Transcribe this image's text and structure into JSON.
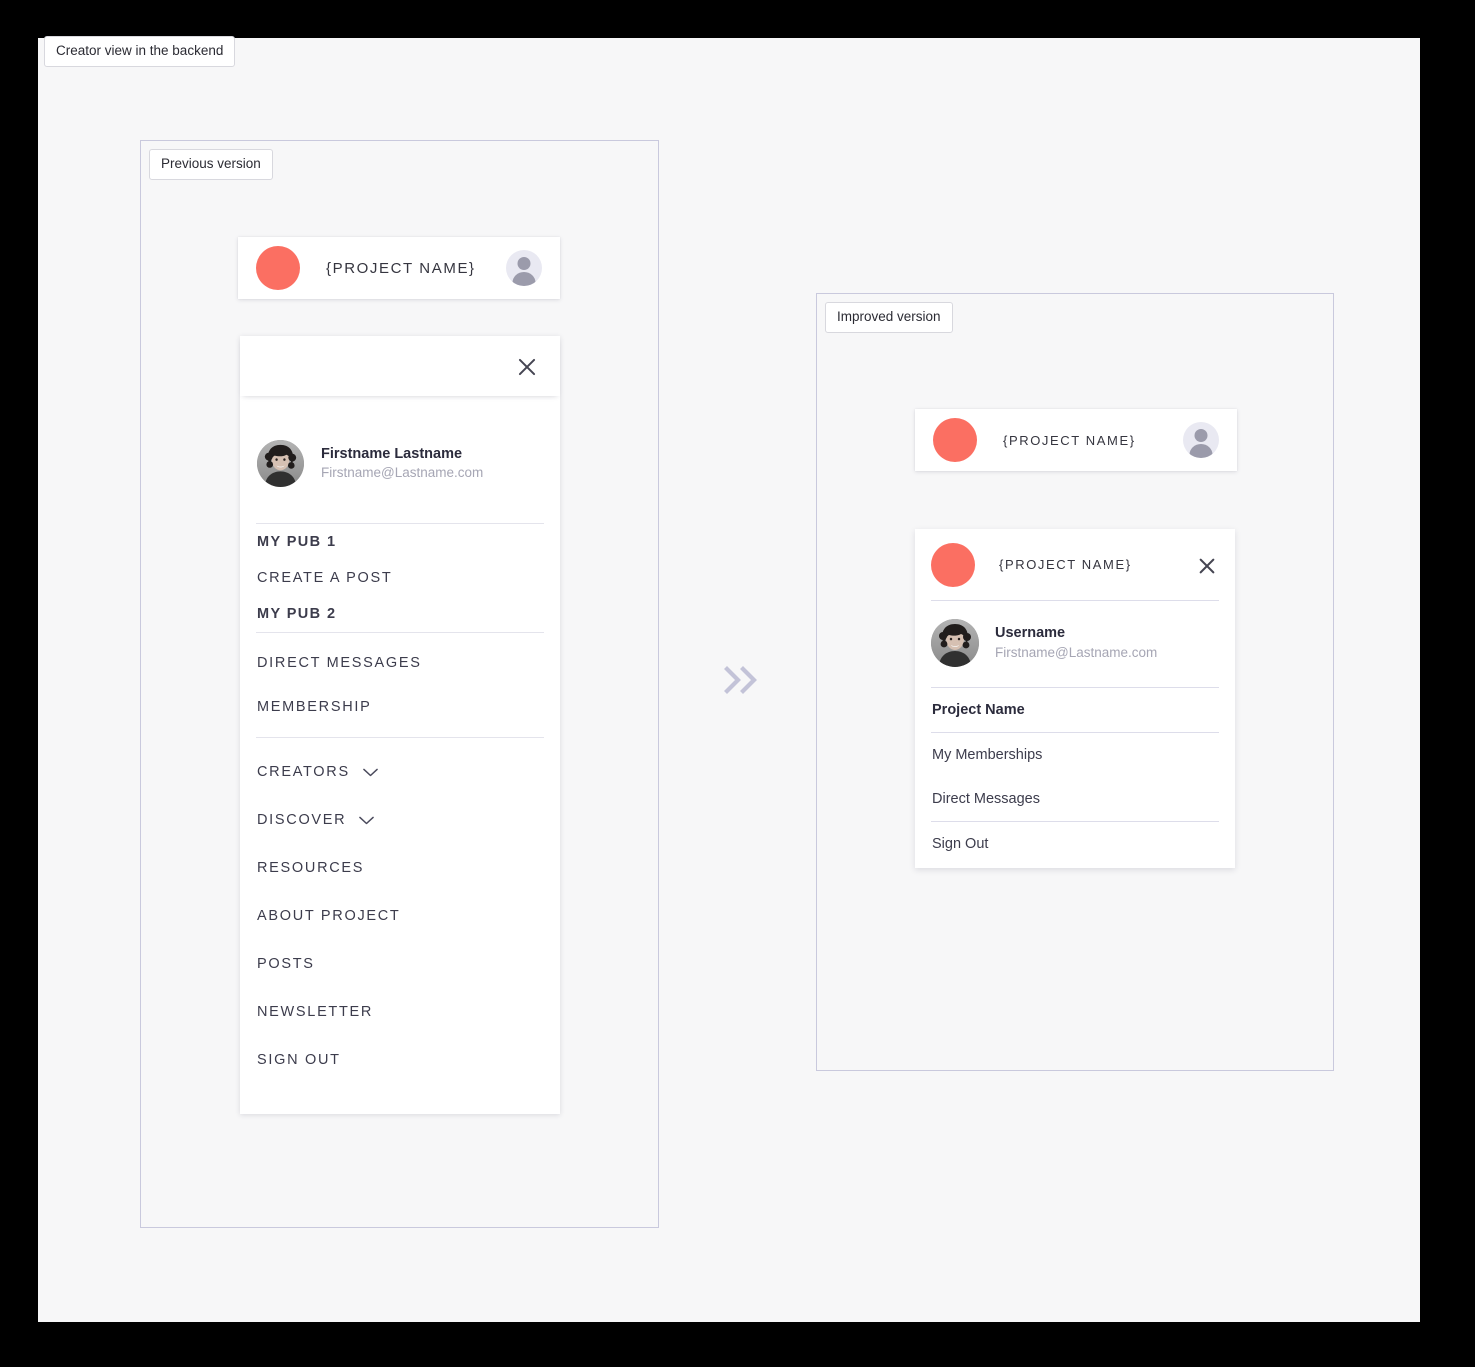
{
  "page": {
    "main_label": "Creator view in the backend",
    "canvas_bg": "#f7f7f8",
    "accent_color": "#fb6f62",
    "panel_border_color": "#c9c9dd"
  },
  "previous": {
    "label": "Previous version",
    "topbar": {
      "brand_icon": "brand-dot-icon",
      "project_name": "{PROJECT NAME}",
      "avatar_icon": "user-avatar-icon"
    },
    "menu": {
      "close_icon": "close-icon",
      "user": {
        "avatar_icon": "user-photo-avatar",
        "name": "Firstname Lastname",
        "email": "Firstname@Lastname.com"
      },
      "group_pubs": [
        {
          "label": "MY PUB 1",
          "style": "bold"
        },
        {
          "label": "CREATE A POST",
          "style": "indent"
        },
        {
          "label": "MY PUB 2",
          "style": "bold"
        }
      ],
      "group_primary": [
        {
          "label": "DIRECT MESSAGES"
        },
        {
          "label": "MEMBERSHIP"
        }
      ],
      "group_secondary": [
        {
          "label": "CREATORS",
          "chevron": "chevron-down-icon"
        },
        {
          "label": "DISCOVER",
          "chevron": "chevron-down-icon"
        },
        {
          "label": "RESOURCES"
        },
        {
          "label": "ABOUT PROJECT"
        },
        {
          "label": "POSTS"
        },
        {
          "label": "NEWSLETTER"
        },
        {
          "label": "SIGN OUT"
        }
      ]
    }
  },
  "transition": {
    "icon": "double-chevron-right-icon",
    "color": "#c3c3d8"
  },
  "improved": {
    "label": "Improved version",
    "topbar": {
      "brand_icon": "brand-dot-icon",
      "project_name": "{PROJECT NAME}",
      "avatar_icon": "user-avatar-icon"
    },
    "menu": {
      "brand_icon": "brand-dot-icon",
      "project_name": "{PROJECT NAME}",
      "close_icon": "close-icon",
      "user": {
        "avatar_icon": "user-photo-avatar",
        "name": "Username",
        "email": "Firstname@Lastname.com"
      },
      "items": [
        {
          "label": "Project Name",
          "style": "bold"
        },
        {
          "label": "My Memberships"
        },
        {
          "label": "Direct Messages"
        },
        {
          "label": "Sign Out"
        }
      ]
    }
  }
}
